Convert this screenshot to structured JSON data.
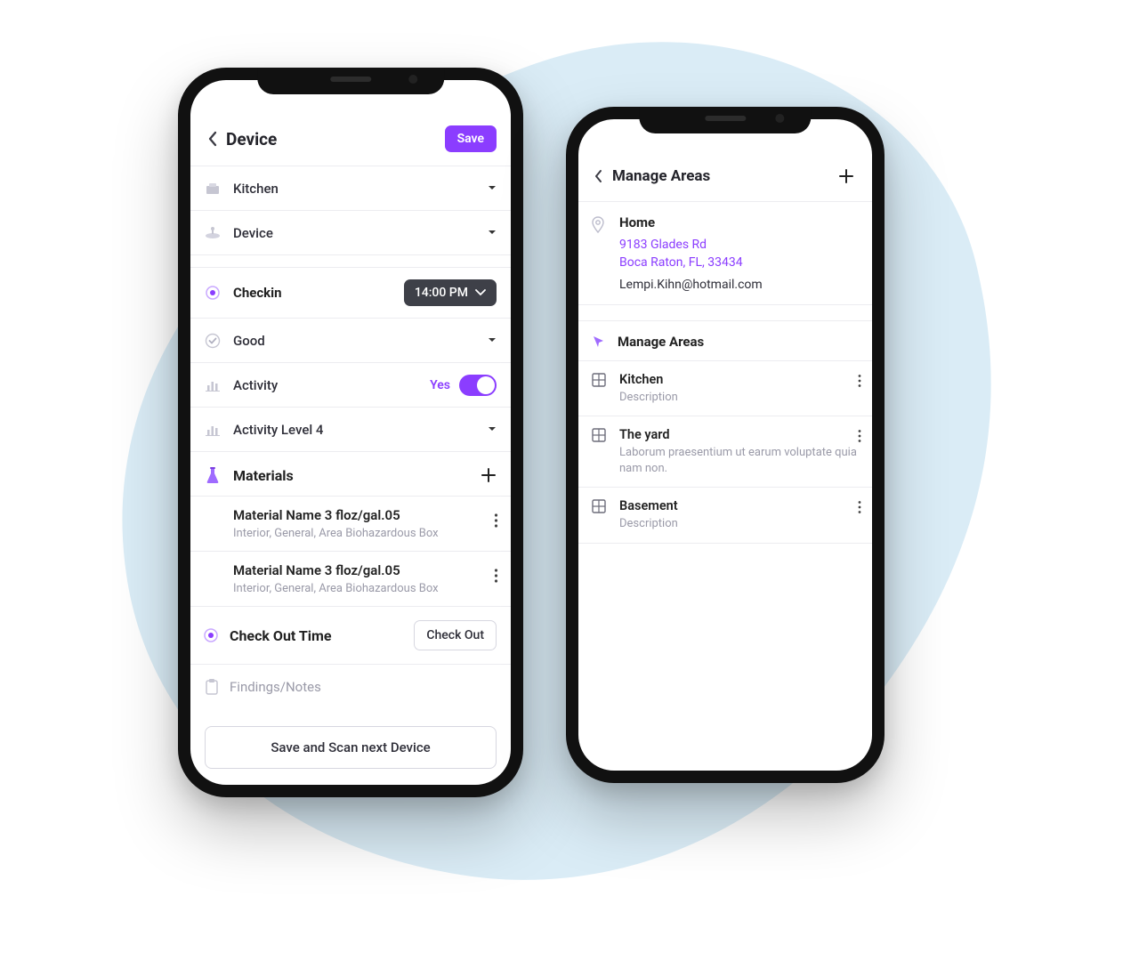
{
  "phone1": {
    "header": {
      "title": "Device",
      "save_label": "Save"
    },
    "rows": {
      "kitchen": "Kitchen",
      "device": "Device",
      "checkin": "Checkin",
      "checkin_time": "14:00 PM",
      "good": "Good",
      "activity": "Activity",
      "activity_yes": "Yes",
      "activity_level": "Activity Level 4"
    },
    "materials_header": "Materials",
    "materials": [
      {
        "title": "Material Name 3 floz/gal.05",
        "sub": "Interior, General, Area Biohazardous Box"
      },
      {
        "title": "Material Name 3 floz/gal.05",
        "sub": "Interior, General, Area Biohazardous Box"
      }
    ],
    "checkout": {
      "label": "Check Out Time",
      "button": "Check Out"
    },
    "notes_placeholder": "Findings/Notes",
    "footer_button": "Save and Scan next Device"
  },
  "phone2": {
    "header": {
      "title": "Manage Areas"
    },
    "home": {
      "name": "Home",
      "address_line1": "9183 Glades Rd",
      "address_line2": "Boca Raton, FL, 33434",
      "email": "Lempi.Kihn@hotmail.com"
    },
    "section_title": "Manage Areas",
    "areas": [
      {
        "title": "Kitchen",
        "sub": "Description"
      },
      {
        "title": "The yard",
        "sub": "Laborum praesentium ut earum voluptate quia nam non."
      },
      {
        "title": "Basement",
        "sub": "Description"
      }
    ]
  }
}
